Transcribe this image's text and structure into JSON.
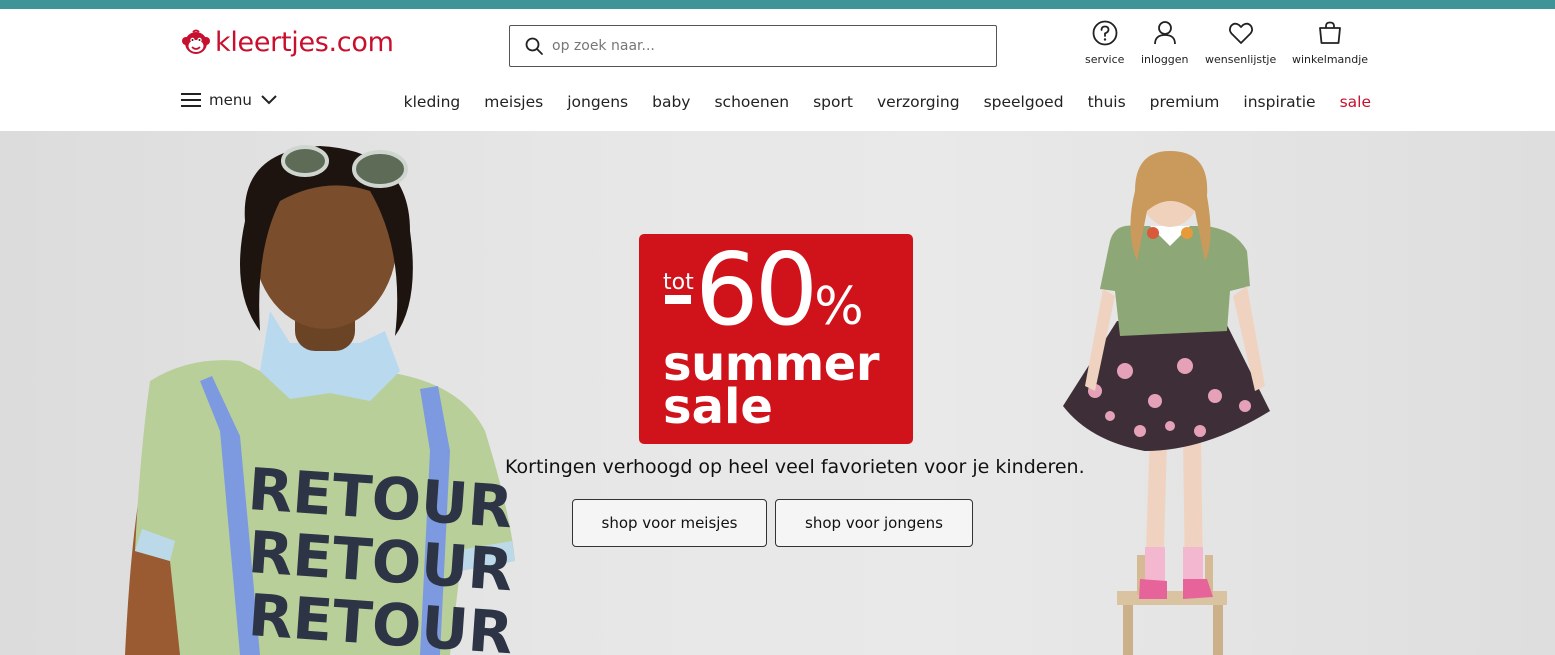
{
  "brand": {
    "name": "kleertjes.com",
    "accent": "#c8102e",
    "topbar_color": "#3f9497"
  },
  "search": {
    "placeholder": "op zoek naar..."
  },
  "utility": [
    {
      "label": "service",
      "icon": "help-circle-icon"
    },
    {
      "label": "inloggen",
      "icon": "user-icon"
    },
    {
      "label": "wensenlijstje",
      "icon": "heart-icon"
    },
    {
      "label": "winkelmandje",
      "icon": "shopping-bag-icon"
    }
  ],
  "menu": {
    "label": "menu"
  },
  "nav": [
    "kleding",
    "meisjes",
    "jongens",
    "baby",
    "schoenen",
    "sport",
    "verzorging",
    "speelgoed",
    "thuis",
    "premium",
    "inspiratie",
    "sale"
  ],
  "hero": {
    "promo": {
      "prefix": "tot",
      "discount": "60",
      "percent": "%",
      "line1": "summer",
      "line2": "sale",
      "bg": "#d0121b"
    },
    "tagline": "Kortingen verhoogd op heel veel favorieten voor je kinderen.",
    "buttons": [
      "shop voor meisjes",
      "shop voor jongens"
    ],
    "shirt_text": [
      "RETOUR",
      "RETOUR",
      "RETOUR"
    ]
  }
}
